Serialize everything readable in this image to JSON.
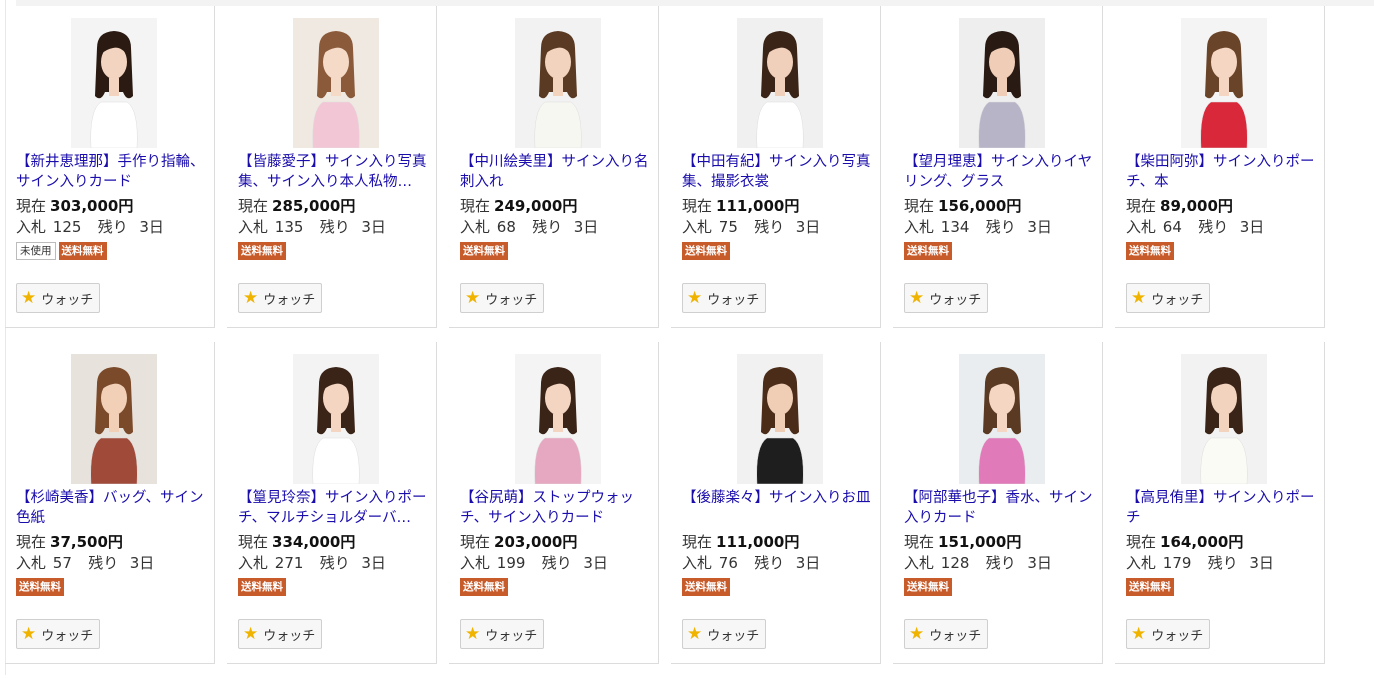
{
  "items": [
    {
      "title": "【新井恵理那】手作り指輪、サイン入りカード",
      "price_label": "現在",
      "price": "303,000円",
      "bids_label": "入札",
      "bids": "125",
      "remain_label": "残り",
      "remain": "3日",
      "unused": "未使用",
      "shipping": "送料無料",
      "watch": "ウォッチ",
      "photo": {
        "bg": "#f4f4f4",
        "hair": "#2a1a12",
        "top": "#ffffff",
        "skin": "#f3d4c0"
      }
    },
    {
      "title": "【皆藤愛子】サイン入り写真集、サイン入り本人私物…",
      "price_label": "現在",
      "price": "285,000円",
      "bids_label": "入札",
      "bids": "135",
      "remain_label": "残り",
      "remain": "3日",
      "unused": "",
      "shipping": "送料無料",
      "watch": "ウォッチ",
      "photo": {
        "bg": "#efe9e2",
        "hair": "#8a5a3a",
        "top": "#f3c6d6",
        "skin": "#f5dac8"
      }
    },
    {
      "title": "【中川絵美里】サイン入り名刺入れ",
      "price_label": "現在",
      "price": "249,000円",
      "bids_label": "入札",
      "bids": "68",
      "remain_label": "残り",
      "remain": "3日",
      "unused": "",
      "shipping": "送料無料",
      "watch": "ウォッチ",
      "photo": {
        "bg": "#f2f2f2",
        "hair": "#5a3a22",
        "top": "#f7f7f2",
        "skin": "#f2d3bd"
      }
    },
    {
      "title": "【中田有紀】サイン入り写真集、撮影衣裳",
      "price_label": "現在",
      "price": "111,000円",
      "bids_label": "入札",
      "bids": "75",
      "remain_label": "残り",
      "remain": "3日",
      "unused": "",
      "shipping": "送料無料",
      "watch": "ウォッチ",
      "photo": {
        "bg": "#f0f0f0",
        "hair": "#3a2418",
        "top": "#ffffff",
        "skin": "#f1d0bb"
      }
    },
    {
      "title": "【望月理恵】サイン入りイヤリング、グラス",
      "price_label": "現在",
      "price": "156,000円",
      "bids_label": "入札",
      "bids": "134",
      "remain_label": "残り",
      "remain": "3日",
      "unused": "",
      "shipping": "送料無料",
      "watch": "ウォッチ",
      "photo": {
        "bg": "#eeeeee",
        "hair": "#2a1a14",
        "top": "#b8b4c8",
        "skin": "#efcdb7"
      }
    },
    {
      "title": "【柴田阿弥】サイン入りポーチ、本",
      "price_label": "現在",
      "price": "89,000円",
      "bids_label": "入札",
      "bids": "64",
      "remain_label": "残り",
      "remain": "3日",
      "unused": "",
      "shipping": "送料無料",
      "watch": "ウォッチ",
      "photo": {
        "bg": "#f4f4f4",
        "hair": "#6a4428",
        "top": "#d8283a",
        "skin": "#f4d6c2"
      }
    },
    {
      "title": "【杉崎美香】バッグ、サイン色紙",
      "price_label": "現在",
      "price": "37,500円",
      "bids_label": "入札",
      "bids": "57",
      "remain_label": "残り",
      "remain": "3日",
      "unused": "",
      "shipping": "送料無料",
      "watch": "ウォッチ",
      "photo": {
        "bg": "#e8e2dc",
        "hair": "#7a4a2a",
        "top": "#a04a3a",
        "skin": "#f2d0b8"
      }
    },
    {
      "title": "【篁見玲奈】サイン入りポーチ、マルチショルダーバ…",
      "price_label": "現在",
      "price": "334,000円",
      "bids_label": "入札",
      "bids": "271",
      "remain_label": "残り",
      "remain": "3日",
      "unused": "",
      "shipping": "送料無料",
      "watch": "ウォッチ",
      "photo": {
        "bg": "#f3f3f3",
        "hair": "#3a2418",
        "top": "#ffffff",
        "skin": "#f3d5c1"
      }
    },
    {
      "title": "【谷尻萌】ストップウォッチ、サイン入りカード",
      "price_label": "現在",
      "price": "203,000円",
      "bids_label": "入札",
      "bids": "199",
      "remain_label": "残り",
      "remain": "3日",
      "unused": "",
      "shipping": "送料無料",
      "watch": "ウォッチ",
      "photo": {
        "bg": "#f4f4f4",
        "hair": "#3a2418",
        "top": "#e6a8c0",
        "skin": "#f3d5c1"
      }
    },
    {
      "title": "【後藤楽々】サイン入りお皿",
      "price_label": "現在",
      "price": "111,000円",
      "bids_label": "入札",
      "bids": "76",
      "remain_label": "残り",
      "remain": "3日",
      "unused": "",
      "shipping": "送料無料",
      "watch": "ウォッチ",
      "photo": {
        "bg": "#f1f1f1",
        "hair": "#4a2c18",
        "top": "#1e1e1e",
        "skin": "#f0cdb5"
      }
    },
    {
      "title": "【阿部華也子】香水、サイン入りカード",
      "price_label": "現在",
      "price": "151,000円",
      "bids_label": "入札",
      "bids": "128",
      "remain_label": "残り",
      "remain": "3日",
      "unused": "",
      "shipping": "送料無料",
      "watch": "ウォッチ",
      "photo": {
        "bg": "#e9edf0",
        "hair": "#5a3a22",
        "top": "#e07ab8",
        "skin": "#f4d6c2"
      }
    },
    {
      "title": "【高見侑里】サイン入りポーチ",
      "price_label": "現在",
      "price": "164,000円",
      "bids_label": "入札",
      "bids": "179",
      "remain_label": "残り",
      "remain": "3日",
      "unused": "",
      "shipping": "送料無料",
      "watch": "ウォッチ",
      "photo": {
        "bg": "#f2f2f2",
        "hair": "#3a2418",
        "top": "#fbfbf6",
        "skin": "#f2d3bd"
      }
    }
  ]
}
